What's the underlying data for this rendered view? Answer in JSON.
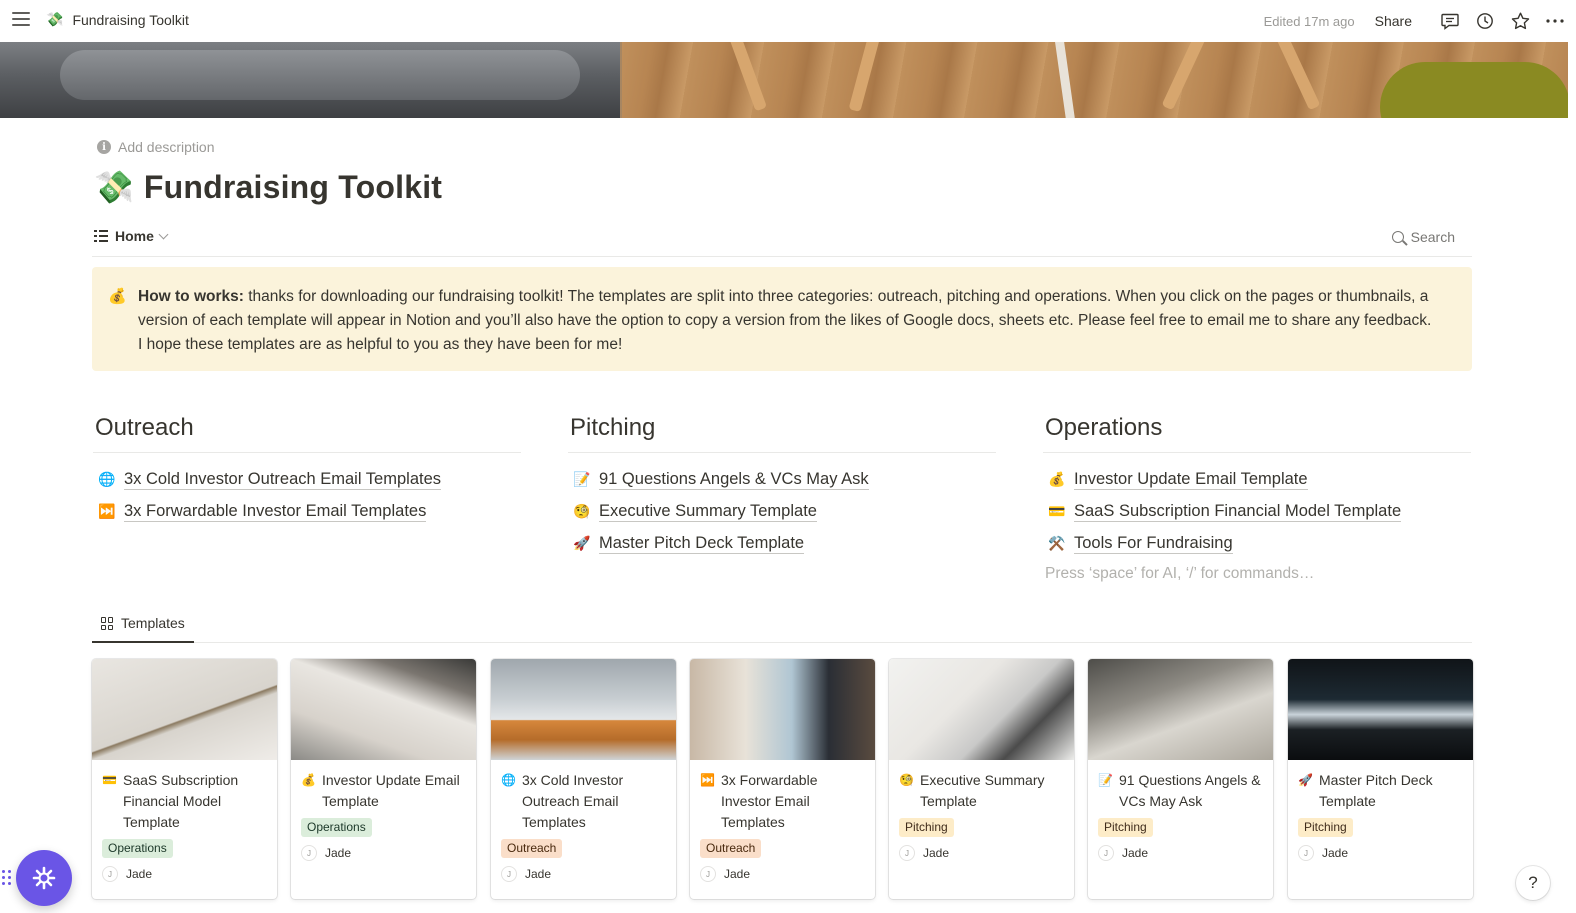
{
  "topbar": {
    "breadcrumb_emoji": "💸",
    "breadcrumb": "Fundraising Toolkit",
    "edited": "Edited 17m ago",
    "share": "Share",
    "icons": [
      "menu-icon",
      "comment-icon",
      "history-icon",
      "star-icon",
      "more-icon"
    ]
  },
  "page": {
    "add_description": "Add description",
    "emoji": "💸",
    "title": "Fundraising Toolkit"
  },
  "viewbar": {
    "view": "Home",
    "search": "Search"
  },
  "callout": {
    "emoji": "💰",
    "bold": "How to works:",
    "text": " thanks for downloading our fundraising toolkit! The templates are split into three categories: outreach, pitching and operations.  When you click on the pages or thumbnails, a version of each template will appear in Notion and you’ll also have the option to copy a version from the likes of Google docs, sheets etc. Please feel free to email me to share any feedback. I hope these templates are as helpful to you as they have been for me!"
  },
  "columns": [
    {
      "heading": "Outreach",
      "items": [
        {
          "emoji": "🌐",
          "label": "3x Cold Investor Outreach Email Templates"
        },
        {
          "emoji": "⏭️",
          "label": "3x Forwardable Investor Email Templates"
        }
      ]
    },
    {
      "heading": "Pitching",
      "items": [
        {
          "emoji": "📝",
          "label": "91 Questions Angels & VCs May Ask"
        },
        {
          "emoji": "🧐",
          "label": "Executive Summary Template"
        },
        {
          "emoji": "🚀",
          "label": "Master Pitch Deck Template"
        }
      ]
    },
    {
      "heading": "Operations",
      "items": [
        {
          "emoji": "💰",
          "label": "Investor Update Email Template"
        },
        {
          "emoji": "💳",
          "label": "SaaS Subscription Financial Model Template"
        },
        {
          "emoji": "⚒️",
          "label": "Tools For Fundraising"
        }
      ],
      "placeholder": "Press ‘space’ for AI, ‘/’ for commands…"
    }
  ],
  "gallery": {
    "tab": "Templates",
    "cards": [
      {
        "emoji": "💳",
        "title": "SaaS Subscription Financial Model Template",
        "tag": "Operations",
        "tag_kind": "ops",
        "person_initial": "J",
        "person": "Jade"
      },
      {
        "emoji": "💰",
        "title": "Investor Update Email Template",
        "tag": "Operations",
        "tag_kind": "ops",
        "person_initial": "J",
        "person": "Jade"
      },
      {
        "emoji": "🌐",
        "title": "3x Cold Investor Outreach Email Templates",
        "tag": "Outreach",
        "tag_kind": "out",
        "person_initial": "J",
        "person": "Jade"
      },
      {
        "emoji": "⏭️",
        "title": "3x Forwardable Investor Email Templates",
        "tag": "Outreach",
        "tag_kind": "out",
        "person_initial": "J",
        "person": "Jade"
      },
      {
        "emoji": "🧐",
        "title": "Executive Summary Template",
        "tag": "Pitching",
        "tag_kind": "pit",
        "person_initial": "J",
        "person": "Jade"
      },
      {
        "emoji": "📝",
        "title": "91 Questions Angels & VCs May Ask",
        "tag": "Pitching",
        "tag_kind": "pit",
        "person_initial": "J",
        "person": "Jade"
      },
      {
        "emoji": "🚀",
        "title": "Master Pitch Deck Template",
        "tag": "Pitching",
        "tag_kind": "pit",
        "person_initial": "J",
        "person": "Jade"
      }
    ]
  },
  "help": "?"
}
